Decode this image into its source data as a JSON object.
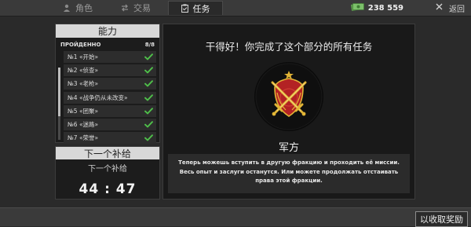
{
  "tabs": [
    {
      "label": "角色",
      "icon": "person-icon",
      "active": false
    },
    {
      "label": "交易",
      "icon": "trade-arrows-icon",
      "active": false
    },
    {
      "label": "任务",
      "icon": "clipboard-icon",
      "active": true
    }
  ],
  "header": {
    "money": "238 559",
    "back_label": "返回"
  },
  "abilities": {
    "title": "能力",
    "passed_label": "ПРОЙДЕННО",
    "passed_count": "8/8",
    "missions": [
      {
        "label": "№1 «开始»",
        "completed": true
      },
      {
        "label": "№2 «侦查»",
        "completed": true
      },
      {
        "label": "№3 «老枪»",
        "completed": true
      },
      {
        "label": "№4 «战争仍从未改变»",
        "completed": true
      },
      {
        "label": "№5 «团聚»",
        "completed": true
      },
      {
        "label": "№6 «迷路»",
        "completed": true
      },
      {
        "label": "№7 «荣誉»",
        "completed": true
      }
    ]
  },
  "supply": {
    "title": "下一个补给",
    "subtitle": "下一个补给",
    "timer": "44 : 47"
  },
  "main": {
    "title": "干得好！你完成了这个部分的所有任务",
    "faction_name": "军方",
    "description": "Теперь можешь вступить в другую фракцию и проходить её миссии. Весь опыт и заслуги останутся. Или можете продолжать отстаивать права этой фракции."
  },
  "footer": {
    "claim_label": "以收取奖励"
  },
  "colors": {
    "check": "#4fc04a",
    "emblem_gold": "#e2b536",
    "emblem_red": "#b32224",
    "money_green": "#7cc06a"
  }
}
